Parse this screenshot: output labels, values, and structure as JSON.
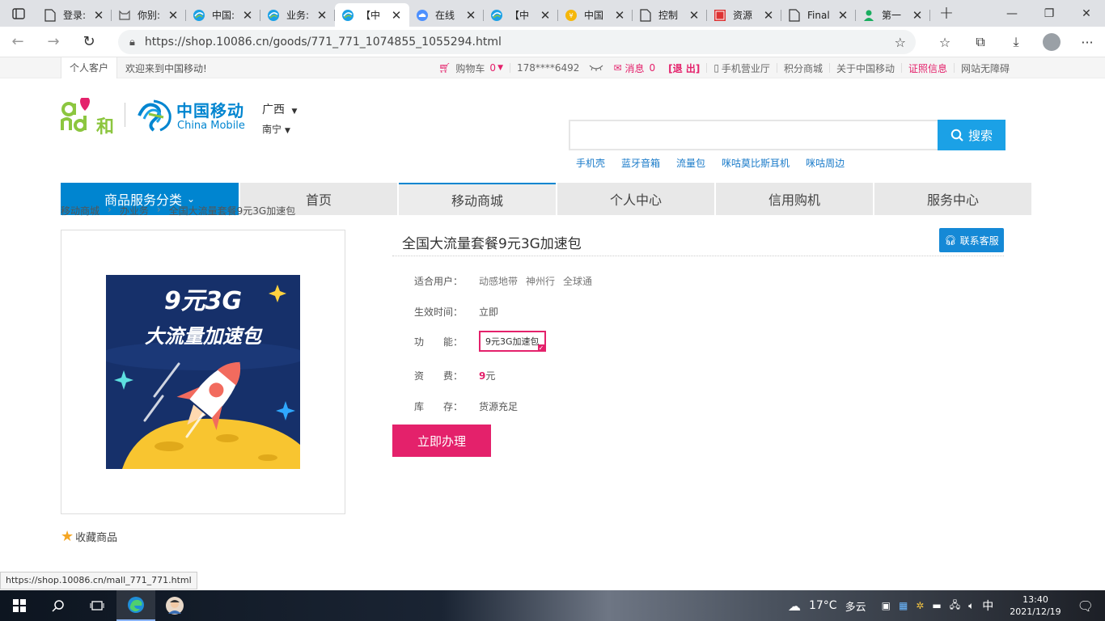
{
  "browser": {
    "tabs": [
      {
        "title": "登录:",
        "icon": "doc-icon"
      },
      {
        "title": "你别:",
        "icon": "cat-icon"
      },
      {
        "title": "中国:",
        "icon": "chinamobile-icon"
      },
      {
        "title": "业务:",
        "icon": "chinamobile-icon"
      },
      {
        "title": "【中",
        "icon": "chinamobile-icon",
        "active": true
      },
      {
        "title": "在线",
        "icon": "cloud-icon"
      },
      {
        "title": "【中",
        "icon": "chinamobile-icon"
      },
      {
        "title": "中国",
        "icon": "coin-icon"
      },
      {
        "title": "控制",
        "icon": "doc-icon"
      },
      {
        "title": "资源",
        "icon": "seal-icon"
      },
      {
        "title": "Final",
        "icon": "doc-icon"
      },
      {
        "title": "第一",
        "icon": "person-icon"
      }
    ],
    "url": "https://shop.10086.cn/goods/771_771_1074855_1055294.html",
    "status_url": "https://shop.10086.cn/mall_771_771.html"
  },
  "topbar": {
    "personal": "个人客户",
    "welcome": "欢迎来到中国移动!",
    "cart": "购物车",
    "cart_count": "0",
    "phone": "178****6492",
    "messages": "消息",
    "messages_count": "0",
    "logout": "[退 出]",
    "mobile_hall": "手机营业厅",
    "points_mall": "积分商城",
    "about": "关于中国移动",
    "license": "证照信息",
    "accessibility": "网站无障碍"
  },
  "header": {
    "logo_cm_cn": "中国移动",
    "logo_cm_en": "China Mobile",
    "logo_and_text": "和",
    "province": "广西",
    "city": "南宁",
    "search_button": "搜索",
    "search_placeholder": "",
    "hotwords": [
      "手机壳",
      "蓝牙音箱",
      "流量包",
      "咪咕莫比斯耳机",
      "咪咕周边"
    ]
  },
  "nav": {
    "category": "商品服务分类",
    "items": [
      "首页",
      "移动商城",
      "个人中心",
      "信用购机",
      "服务中心"
    ],
    "active": "移动商城"
  },
  "breadcrumb": [
    "移动商城",
    "办业务",
    "全国大流量套餐9元3G加速包"
  ],
  "product": {
    "title": "全国大流量套餐9元3G加速包",
    "image_line1": "9元3G",
    "image_line2": "大流量加速包",
    "service_button": "联系客服",
    "users_label": "适合用户：",
    "users": [
      "动感地带",
      "神州行",
      "全球通"
    ],
    "effective_label": "生效时间：",
    "effective": "立即",
    "function_label": "功　　能：",
    "function": "9元3G加速包",
    "fee_label": "资　　费：",
    "fee_amount": "9",
    "fee_unit": "元",
    "stock_label": "库　　存：",
    "stock": "货源充足",
    "buy_button": "立即办理",
    "collect": "收藏商品"
  },
  "taskbar": {
    "weather": "17°C",
    "weather_desc": "多云",
    "ime": "中",
    "time": "13:40",
    "date": "2021/12/19"
  },
  "colors": {
    "brand_blue": "#0085d0",
    "accent_pink": "#e4216b",
    "search_blue": "#1ba1e6"
  }
}
